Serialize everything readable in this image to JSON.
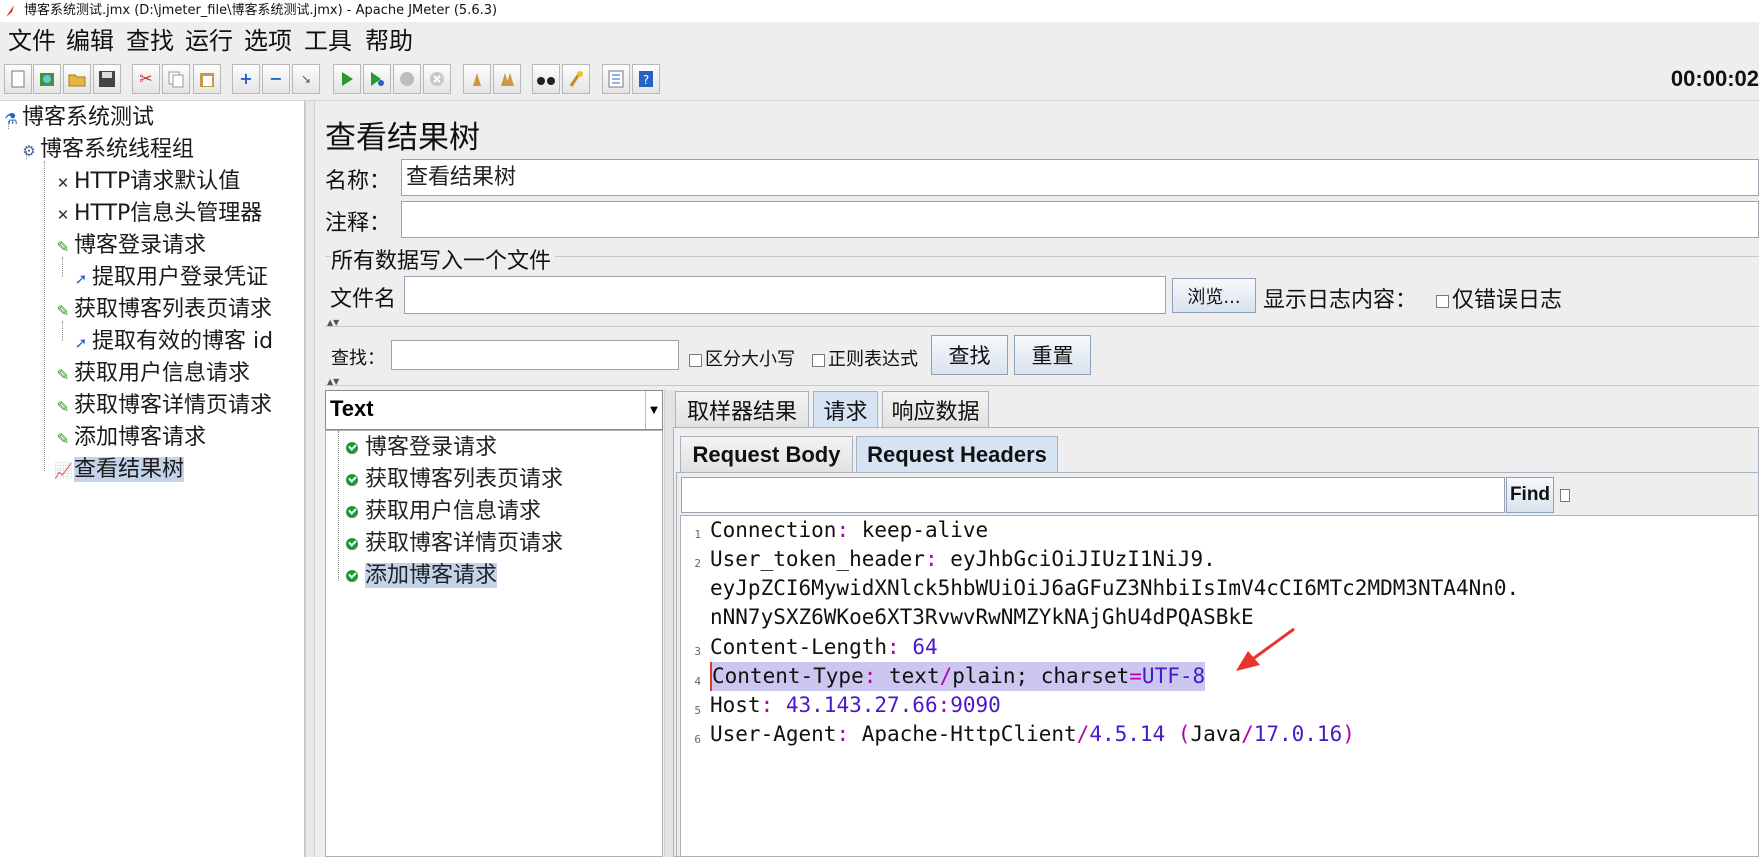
{
  "window": {
    "title": "博客系统测试.jmx (D:\\jmeter_file\\博客系统测试.jmx) - Apache JMeter (5.6.3)"
  },
  "menu": [
    "文件",
    "编辑",
    "查找",
    "运行",
    "选项",
    "工具",
    "帮助"
  ],
  "toolbar": {
    "buttons": [
      "new-icon",
      "templates-icon",
      "open-icon",
      "save-icon",
      "cut-icon",
      "copy-icon",
      "paste-icon",
      "expand-icon",
      "collapse-icon",
      "toggle-icon",
      "start-icon",
      "start-no-pause-icon",
      "stop-icon",
      "shutdown-icon",
      "clear-icon",
      "clear-all-icon",
      "search-icon",
      "reset-search-icon",
      "function-helper-icon",
      "help-icon"
    ],
    "timer": "00:00:02"
  },
  "tree": {
    "nodes": [
      {
        "label": "博客系统测试",
        "icon": "flask-icon"
      },
      {
        "label": "博客系统线程组",
        "icon": "gear-icon"
      },
      {
        "label": "HTTP请求默认值",
        "icon": "wrench-icon"
      },
      {
        "label": "HTTP信息头管理器",
        "icon": "wrench-icon"
      },
      {
        "label": "博客登录请求",
        "icon": "pipette-icon"
      },
      {
        "label": "提取用户登录凭证",
        "icon": "extractor-icon"
      },
      {
        "label": "获取博客列表页请求",
        "icon": "pipette-icon"
      },
      {
        "label": "提取有效的博客 id",
        "icon": "extractor-icon"
      },
      {
        "label": "获取用户信息请求",
        "icon": "pipette-icon"
      },
      {
        "label": "获取博客详情页请求",
        "icon": "pipette-icon"
      },
      {
        "label": "添加博客请求",
        "icon": "pipette-icon"
      },
      {
        "label": "查看结果树",
        "icon": "chart-icon"
      }
    ]
  },
  "panel": {
    "title": "查看结果树",
    "name_label": "名称：",
    "name_value": "查看结果树",
    "comment_label": "注释：",
    "comment_value": "",
    "file_section": "所有数据写入一个文件",
    "filename_label": "文件名",
    "filename_value": "",
    "browse": "浏览...",
    "log_label": "显示日志内容：",
    "errors_only": "仅错误日志"
  },
  "search": {
    "label": "查找：",
    "value": "",
    "case_sensitive": "区分大小写",
    "regex": "正则表达式",
    "find": "查找",
    "reset": "重置"
  },
  "renderer": "Text",
  "samples": [
    "博客登录请求",
    "获取博客列表页请求",
    "获取用户信息请求",
    "获取博客详情页请求",
    "添加博客请求"
  ],
  "tabs": [
    "取样器结果",
    "请求",
    "响应数据"
  ],
  "subtabs": [
    "Request Body",
    "Request Headers"
  ],
  "find_button": "Find",
  "headers": {
    "line_numbers": [
      "1",
      "2",
      "3",
      "4",
      "5",
      "6"
    ],
    "connection_key": "Connection",
    "connection_val": "keep-alive",
    "token_key": "User_token_header",
    "token_val1": "eyJhbGciOiJIUzI1NiJ9.",
    "token_val2": "eyJpZCI6MywidXNlck5hbWUiOiJ6aGFuZ3NhbiIsImV4cCI6MTc2MDM3NTA4Nn0.",
    "token_val3": "nNN7ySXZ6WKoe6XT3RvwvRwNMZYkNAjGhU4dPQASBkE",
    "length_key": "Content-Length",
    "length_val": "64",
    "type_key": "Content-Type",
    "type_val_a": "text",
    "type_val_b": "plain; charset",
    "type_val_c": "UTF-8",
    "host_key": "Host",
    "host_ip": "43.143.27.66",
    "host_port": "9090",
    "ua_key": "User-Agent",
    "ua_a": "Apache-HttpClient",
    "ua_b": "4.5.14",
    "ua_c": "Java",
    "ua_d": "17.0.16"
  },
  "colors": {
    "accent": "#e8352c",
    "selection": "#c3d3ea",
    "keyword": "#4a18c8",
    "punct": "#b000b0"
  }
}
